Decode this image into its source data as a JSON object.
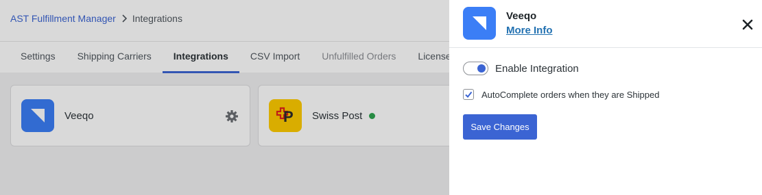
{
  "breadcrumb": {
    "parent": "AST Fulfillment Manager",
    "current": "Integrations",
    "separator_icon": "chevron-right-icon"
  },
  "tabs": [
    {
      "label": "Settings"
    },
    {
      "label": "Shipping Carriers"
    },
    {
      "label": "Integrations",
      "active": true
    },
    {
      "label": "CSV Import"
    },
    {
      "label": "Unfulfilled Orders"
    },
    {
      "label": "License"
    }
  ],
  "cards": [
    {
      "name": "Veeqo",
      "logo": "veeqo-logo",
      "action_icon": "gear-icon"
    },
    {
      "name": "Swiss Post",
      "logo": "swiss-post-logo",
      "status": "active"
    }
  ],
  "panel": {
    "title": "Veeqo",
    "more_info": "More Info",
    "close_icon": "close-icon",
    "enable_label": "Enable Integration",
    "enable_on": true,
    "autocomplete_label": "AutoComplete orders when they are Shipped",
    "autocomplete_checked": true,
    "save_label": "Save Changes"
  },
  "colors": {
    "accent": "#3b64d3",
    "link": "#2271b1",
    "veeqo": "#3b7ef6",
    "swiss_post": "#ffcc00",
    "status_green": "#2ea44f"
  }
}
